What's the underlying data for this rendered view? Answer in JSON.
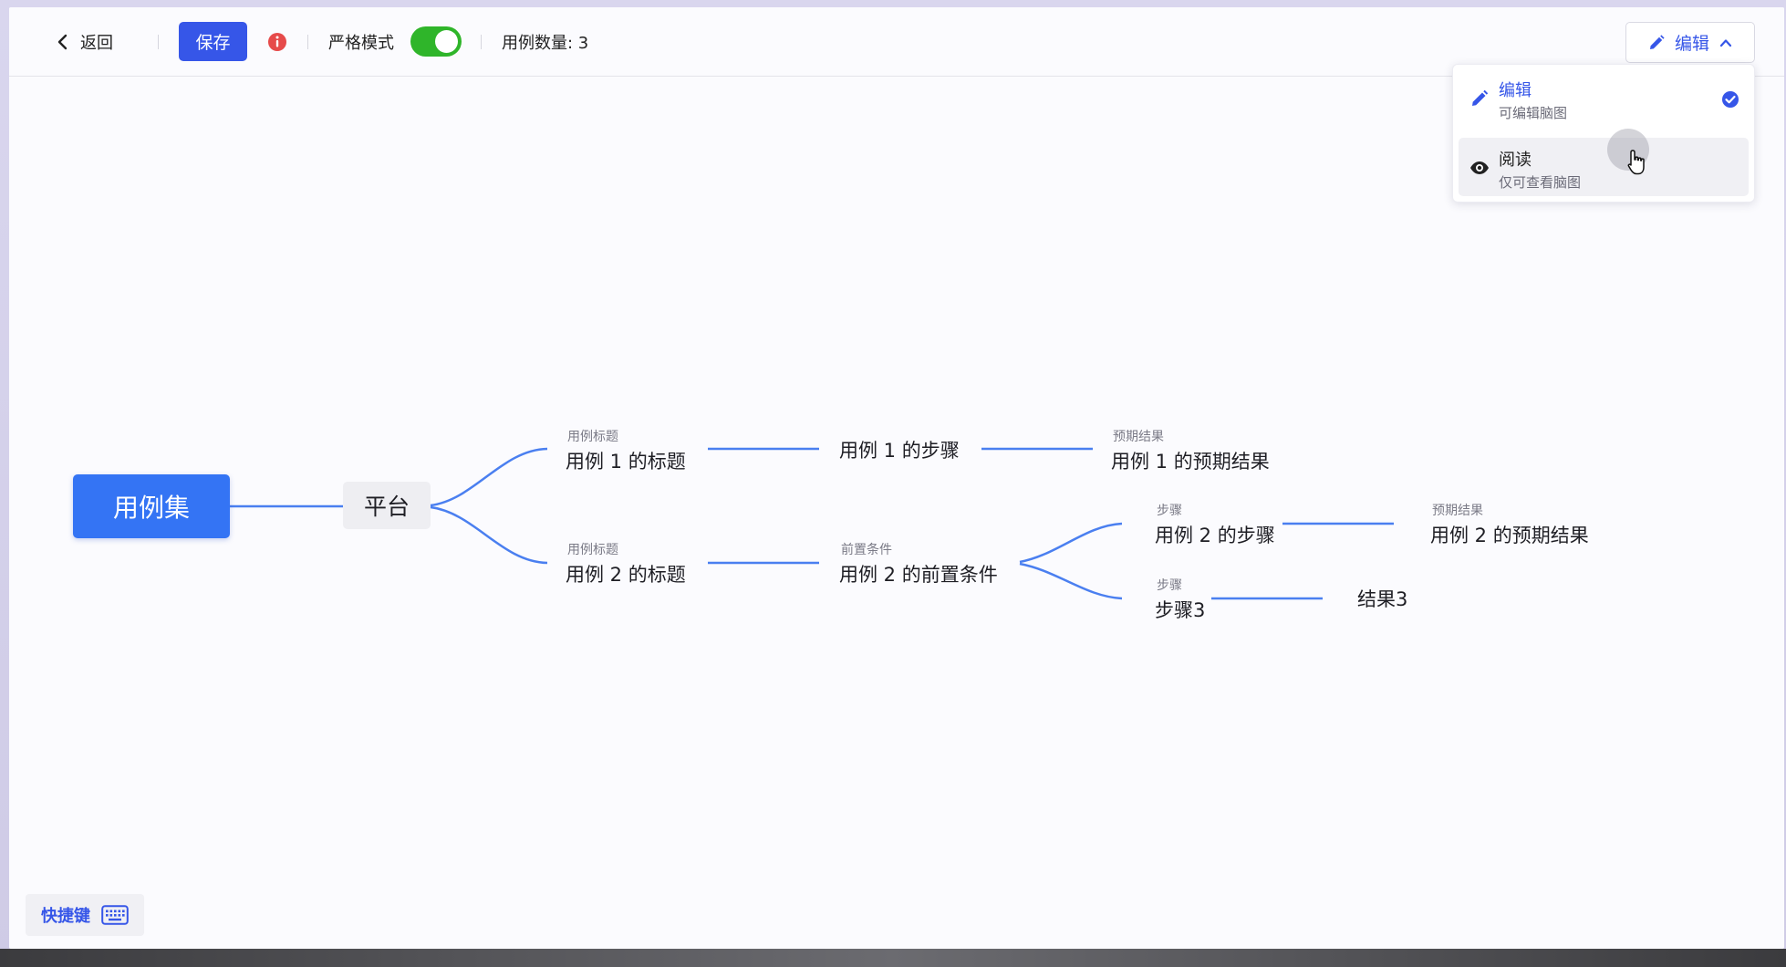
{
  "toolbar": {
    "back_label": "返回",
    "save_label": "保存",
    "strict_label": "严格模式",
    "strict_enabled": true,
    "case_count_label": "用例数量: 3",
    "mode_button_label": "编辑"
  },
  "mode_menu": {
    "items": [
      {
        "title": "编辑",
        "desc": "可编辑脑图",
        "selected": true
      },
      {
        "title": "阅读",
        "desc": "仅可查看脑图",
        "selected": false
      }
    ]
  },
  "mindmap": {
    "root": "用例集",
    "platform": "平台",
    "case1_title_tag": "用例标题",
    "case1_title": "用例 1 的标题",
    "case1_steps": "用例 1 的步骤",
    "case1_expected_tag": "预期结果",
    "case1_expected": "用例 1 的预期结果",
    "case2_title_tag": "用例标题",
    "case2_title": "用例 2 的标题",
    "case2_precond_tag": "前置条件",
    "case2_precond": "用例 2 的前置条件",
    "case2_step_tag": "步骤",
    "case2_step": "用例 2 的步骤",
    "case2_expected_tag": "预期结果",
    "case2_expected": "用例 2 的预期结果",
    "case3_step_tag": "步骤",
    "case3_step": "步骤3",
    "case3_result": "结果3"
  },
  "shortcuts": {
    "label": "快捷键"
  },
  "colors": {
    "accent": "#3656e8",
    "root_node": "#3474f4",
    "toggle_on": "#2fb52a",
    "info_icon": "#e64a4a",
    "link": "#4a7ff0"
  },
  "icons": {
    "back": "chevron-left-icon",
    "info": "info-circle-icon",
    "edit": "pencil-icon",
    "chevron": "chevron-up-icon",
    "read": "eye-icon",
    "check": "check-circle-icon",
    "keyboard": "keyboard-icon"
  }
}
